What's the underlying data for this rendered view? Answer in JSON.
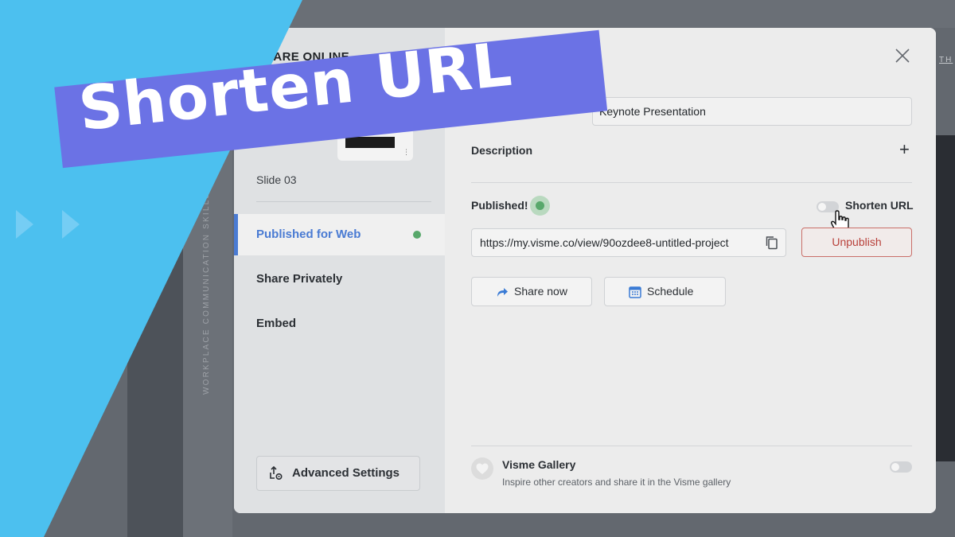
{
  "banner": {
    "text": "Shorten URL"
  },
  "background": {
    "vertical_text": "WORKPLACE COMMUNICATION SKILLS",
    "corner_text": "TH"
  },
  "modal": {
    "title": "SHARE ONLINE",
    "slide_label": "Slide 03",
    "nav": [
      {
        "label": "Published for Web",
        "active": true
      },
      {
        "label": "Share Privately",
        "active": false
      },
      {
        "label": "Embed",
        "active": false
      }
    ],
    "advanced_settings_label": "Advanced Settings",
    "project_name": "Keynote Presentation",
    "description_label": "Description",
    "published_label": "Published!",
    "shorten_url_label": "Shorten URL",
    "shorten_url_enabled": false,
    "url_value": "https://my.visme.co/view/90ozdee8-untitled-project",
    "unpublish_label": "Unpublish",
    "share_now_label": "Share now",
    "schedule_label": "Schedule",
    "gallery": {
      "title": "Visme Gallery",
      "description": "Inspire other creators and share it in the Visme gallery",
      "enabled": false
    }
  },
  "colors": {
    "brand_blue": "#4cc0ef",
    "banner_purple": "#6b72e5",
    "active_nav": "#4a7bd3",
    "status_green": "#58a86b",
    "danger_red": "#b8403a"
  }
}
